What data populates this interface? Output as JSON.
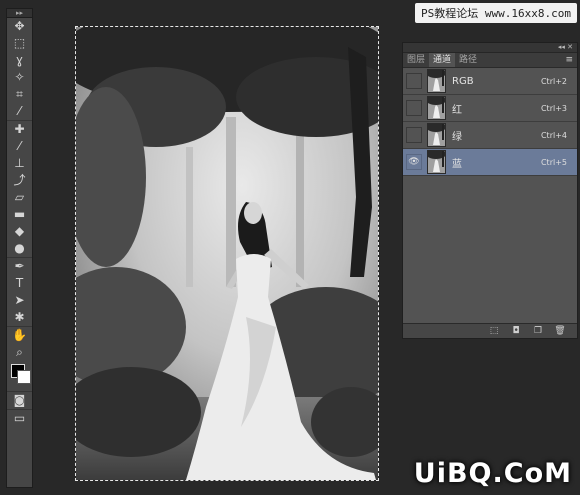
{
  "watermark": {
    "text": "PS教程论坛 www.16xx8.com"
  },
  "logo": {
    "text": "UiBQ.CoM"
  },
  "toolbox": {
    "grip": "▸▸",
    "tools": [
      {
        "name": "move-tool-icon",
        "glyph": "✥"
      },
      {
        "name": "marquee-tool-icon",
        "glyph": "⬚"
      },
      {
        "name": "lasso-tool-icon",
        "glyph": "ɣ"
      },
      {
        "name": "magic-wand-tool-icon",
        "glyph": "✧"
      },
      {
        "name": "crop-tool-icon",
        "glyph": "⌗"
      },
      {
        "name": "eyedropper-tool-icon",
        "glyph": "⁄"
      },
      {
        "name": "healing-brush-tool-icon",
        "glyph": "✚"
      },
      {
        "name": "brush-tool-icon",
        "glyph": "⁄"
      },
      {
        "name": "clone-stamp-tool-icon",
        "glyph": "⊥"
      },
      {
        "name": "history-brush-tool-icon",
        "glyph": "⤴"
      },
      {
        "name": "eraser-tool-icon",
        "glyph": "▱"
      },
      {
        "name": "gradient-tool-icon",
        "glyph": "▬"
      },
      {
        "name": "blur-tool-icon",
        "glyph": "◆"
      },
      {
        "name": "dodge-tool-icon",
        "glyph": "●"
      },
      {
        "name": "pen-tool-icon",
        "glyph": "✒"
      },
      {
        "name": "type-tool-icon",
        "glyph": "T"
      },
      {
        "name": "path-selection-tool-icon",
        "glyph": "➤"
      },
      {
        "name": "shape-tool-icon",
        "glyph": "✱"
      },
      {
        "name": "hand-tool-icon",
        "glyph": "✋"
      },
      {
        "name": "zoom-tool-icon",
        "glyph": "⌕"
      }
    ],
    "bottom": [
      {
        "name": "quick-mask-icon",
        "glyph": "◙"
      },
      {
        "name": "screen-mode-icon",
        "glyph": "▭"
      }
    ]
  },
  "panel": {
    "top_glyph": "◂◂ ✕",
    "tabs": [
      "图层",
      "通道",
      "路径"
    ],
    "active_tab": 1,
    "menu_glyph": "≡",
    "channels": [
      {
        "name": "RGB",
        "shortcut": "Ctrl+2",
        "visible": false,
        "selected": false
      },
      {
        "name": "红",
        "shortcut": "Ctrl+3",
        "visible": false,
        "selected": false
      },
      {
        "name": "绿",
        "shortcut": "Ctrl+4",
        "visible": false,
        "selected": false
      },
      {
        "name": "蓝",
        "shortcut": "Ctrl+5",
        "visible": true,
        "selected": true
      }
    ],
    "eye_glyph": "👁",
    "bottom_buttons": [
      {
        "name": "load-selection-icon",
        "glyph": "⬚"
      },
      {
        "name": "save-selection-icon",
        "glyph": "◘"
      },
      {
        "name": "new-channel-icon",
        "glyph": "❐"
      },
      {
        "name": "delete-channel-icon",
        "glyph": "🗑"
      }
    ]
  }
}
